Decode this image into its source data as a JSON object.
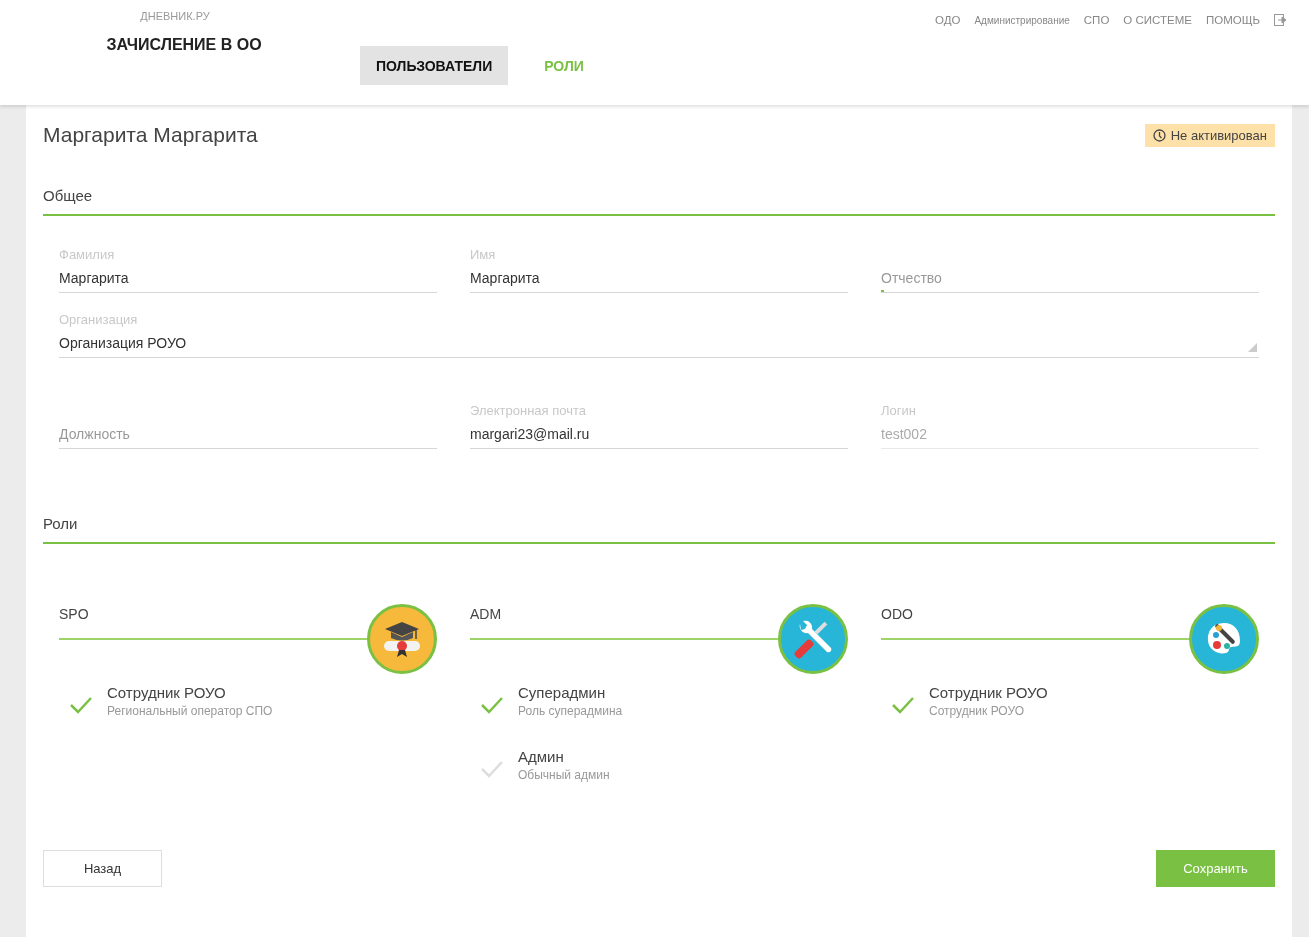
{
  "header": {
    "brand": "ДНЕВНИК.РУ",
    "section_title": "ЗАЧИСЛЕНИЕ В ОО",
    "tabs": [
      {
        "label": "ПОЛЬЗОВАТЕЛИ",
        "selected": true
      },
      {
        "label": "РОЛИ",
        "selected": false
      }
    ],
    "top_nav": [
      {
        "label": "ОДО",
        "kind": "normal"
      },
      {
        "label": "Администрирование",
        "kind": "small"
      },
      {
        "label": "СПО",
        "kind": "normal"
      },
      {
        "label": "О СИСТЕМЕ",
        "kind": "normal"
      },
      {
        "label": "ПОМОЩЬ",
        "kind": "normal"
      }
    ]
  },
  "user": {
    "name": "Маргарита Маргарита",
    "status": "Не активирован"
  },
  "general": {
    "title": "Общее",
    "rows": [
      [
        {
          "label": "Фамилия",
          "value": "Маргарита",
          "focused": false,
          "disabled": false
        },
        {
          "label": "Имя",
          "value": "Маргарита",
          "focused": false,
          "disabled": false
        },
        {
          "placeholder": "Отчество",
          "focused": true,
          "disabled": false
        }
      ],
      [
        {
          "label": "Организация",
          "value": "Организация РОУО",
          "kind": "select",
          "focused": false,
          "disabled": false
        }
      ],
      [
        {
          "placeholder": "Должность",
          "focused": false,
          "disabled": false
        },
        {
          "label": "Электронная почта",
          "value": "margari23@mail.ru",
          "focused": false,
          "disabled": false
        },
        {
          "label": "Логин",
          "value": "test002",
          "focused": false,
          "disabled": true
        }
      ]
    ]
  },
  "roles": {
    "title": "Роли",
    "groups": [
      {
        "name": "SPO",
        "kind": "graduation",
        "roles": [
          {
            "title": "Сотрудник РОУО",
            "description": "Региональный оператор СПО",
            "checked": true
          }
        ]
      },
      {
        "name": "ADM",
        "kind": "tools",
        "roles": [
          {
            "title": "Суперадмин",
            "description": "Роль суперадмина",
            "checked": true
          },
          {
            "title": "Админ",
            "description": "Обычный админ",
            "checked": false
          }
        ]
      },
      {
        "name": "ODO",
        "kind": "palette",
        "roles": [
          {
            "title": "Сотрудник РОУО",
            "description": "Сотрудник РОУО",
            "checked": true
          }
        ]
      }
    ]
  },
  "buttons": {
    "back": "Назад",
    "save": "Сохранить"
  }
}
